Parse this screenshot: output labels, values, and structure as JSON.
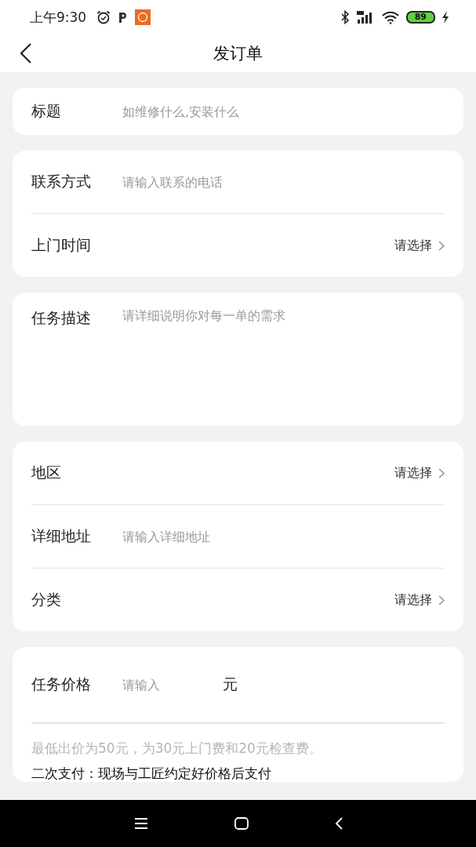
{
  "status_bar": {
    "time": "上午9:30",
    "battery": "89"
  },
  "header": {
    "title": "发订单"
  },
  "cards": [
    {
      "rows": [
        {
          "kind": "input",
          "label": "标题",
          "placeholder": "如维修什么,安装什么"
        }
      ]
    },
    {
      "rows": [
        {
          "kind": "input",
          "label": "联系方式",
          "placeholder": "请输入联系的电话"
        },
        {
          "kind": "select",
          "label": "上门时间",
          "value": "请选择"
        }
      ]
    },
    {
      "rows": [
        {
          "kind": "textarea",
          "label": "任务描述",
          "placeholder": "请详细说明你对每一单的需求"
        }
      ]
    },
    {
      "rows": [
        {
          "kind": "select",
          "label": "地区",
          "value": "请选择"
        },
        {
          "kind": "input",
          "label": "详细地址",
          "placeholder": "请输入详细地址"
        },
        {
          "kind": "select",
          "label": "分类",
          "value": "请选择"
        }
      ]
    },
    {
      "rows": [
        {
          "kind": "price",
          "label": "任务价格",
          "placeholder": "请输入",
          "unit": "元"
        }
      ],
      "notes": [
        {
          "kind": "hint",
          "text": "最低出价为50元，为30元上门费和20元检查费。"
        },
        {
          "kind": "info",
          "text": "二次支付：现场与工匠约定好价格后支付"
        }
      ]
    }
  ]
}
